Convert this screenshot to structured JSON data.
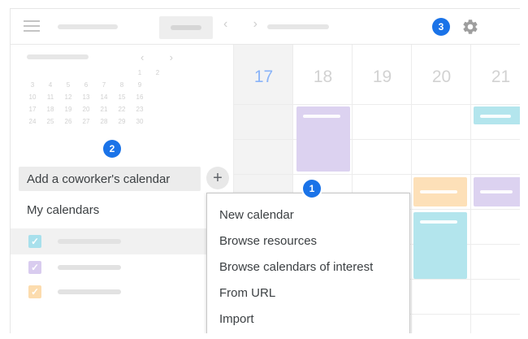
{
  "badges": {
    "menu_badge": "1",
    "add_badge": "2",
    "settings_badge": "3"
  },
  "sidebar": {
    "add_coworker_label": "Add a coworker's calendar",
    "add_button_glyph": "+",
    "my_calendars_label": "My calendars",
    "mini_calendar_days": [
      "1",
      "2",
      "3",
      "4",
      "5",
      "6",
      "7",
      "8",
      "9",
      "10",
      "11",
      "12",
      "13",
      "14",
      "15",
      "16",
      "17",
      "18",
      "19",
      "20",
      "21",
      "22",
      "23",
      "24",
      "25",
      "26",
      "27",
      "28",
      "29",
      "30"
    ]
  },
  "calendar": {
    "days": [
      "17",
      "18",
      "19",
      "20",
      "21"
    ],
    "today": "17"
  },
  "dropdown": {
    "items": [
      "New calendar",
      "Browse resources",
      "Browse calendars of interest",
      "From URL",
      "Import"
    ]
  },
  "colors": {
    "accent": "#1a73e8",
    "event_purple": "#dcd2f0",
    "event_cyan": "#b3e5ed",
    "event_orange": "#fde0b8",
    "check_cyan": "#a8e0ec",
    "check_purple": "#d9ccef",
    "check_orange": "#fcdcae"
  }
}
